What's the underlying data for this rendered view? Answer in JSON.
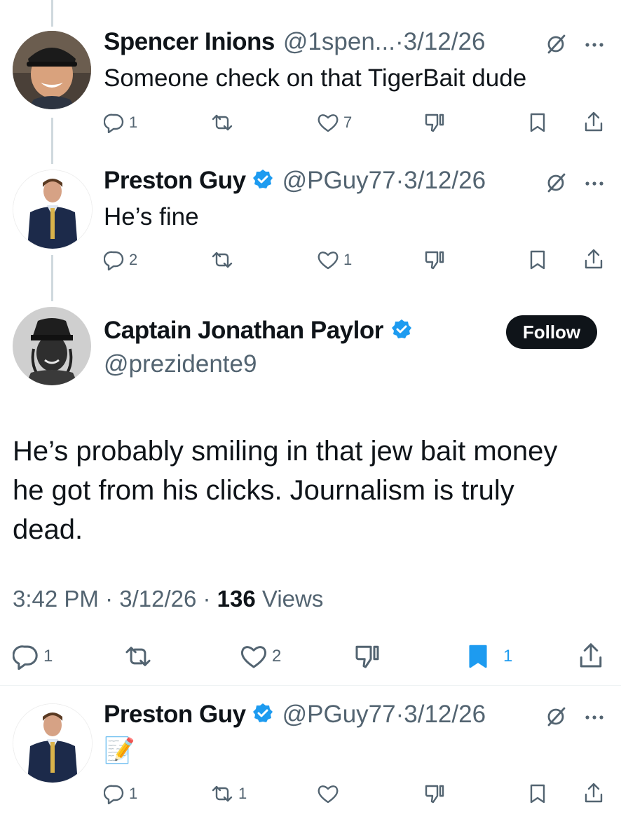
{
  "colors": {
    "accent": "#1d9bf0",
    "text": "#0f1419",
    "secondary": "#536471",
    "thread_line": "#cfd9de"
  },
  "tweets": [
    {
      "name": "Spencer Inions",
      "handle": "@1spen...",
      "sep": "·",
      "date": "3/12/26",
      "verified": false,
      "text": "Someone check on that TigerBait dude",
      "replies": "1",
      "retweets": "",
      "likes": "7"
    },
    {
      "name": "Preston Guy",
      "handle": "@PGuy77",
      "sep": "·",
      "date": "3/12/26",
      "verified": true,
      "text": "He’s fine",
      "replies": "2",
      "retweets": "",
      "likes": "1"
    }
  ],
  "main_tweet": {
    "name": "Captain Jonathan Paylor",
    "handle": "@prezidente9",
    "verified": true,
    "follow_label": "Follow",
    "text_lines": [
      "He’s probably smiling in that jew bait money",
      "he got from his clicks. Journalism is truly",
      "dead."
    ],
    "time": "3:42 PM",
    "sep": " · ",
    "date": "3/12/26",
    "views_count": "136",
    "views_label": "Views",
    "replies": "1",
    "likes": "2",
    "bookmarks": "1"
  },
  "reply_tweet": {
    "name": "Preston Guy",
    "handle": "@PGuy77",
    "sep": "·",
    "date": "3/12/26",
    "verified": true,
    "text": "📝",
    "replies": "1",
    "retweets": "1",
    "likes": ""
  },
  "icons": [
    "reply-icon",
    "retweet-icon",
    "like-icon",
    "downvote-icon",
    "bookmark-icon",
    "share-icon",
    "grok-icon",
    "more-icon",
    "verified-badge-icon"
  ]
}
